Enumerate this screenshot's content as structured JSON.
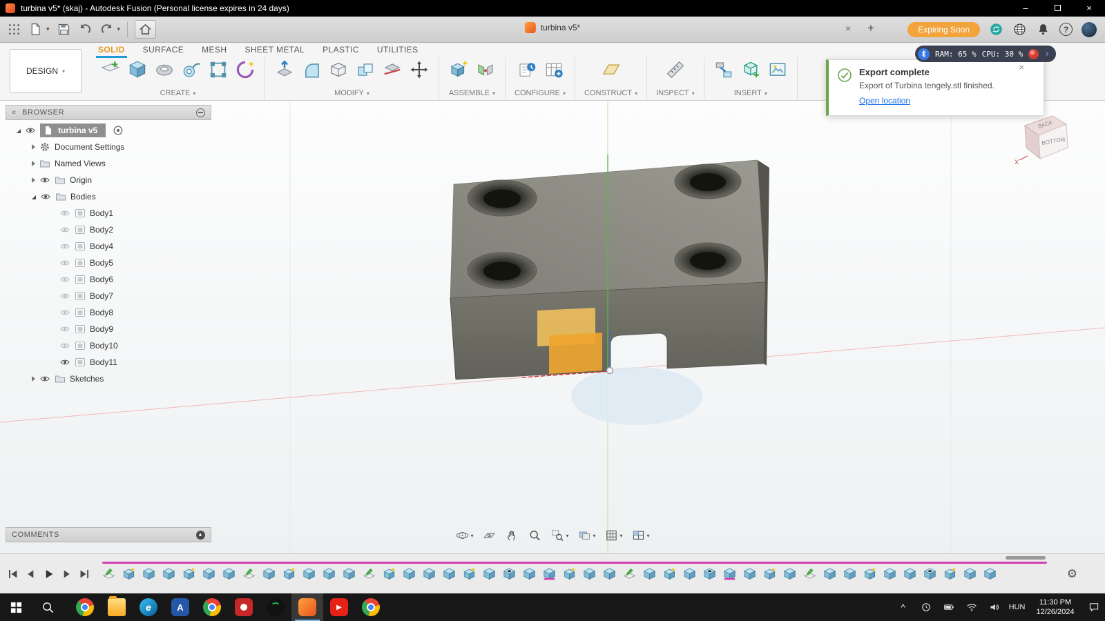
{
  "glyphs": {
    "close": "×",
    "minimize": "–",
    "caret_down": "▾",
    "plus": "+",
    "chevron": "›",
    "caret_up": "^",
    "gear": "⚙",
    "collapse_left": "«",
    "question": "?"
  },
  "titlebar": {
    "title": "turbina v5* (skaj) - Autodesk Fusion (Personal license expires in 24 days)"
  },
  "qat": {
    "doc_tab": "turbina v5*",
    "license_badge": "Expiring Soon"
  },
  "ribbon": {
    "design_menu": "DESIGN",
    "tabs": [
      {
        "label": "SOLID",
        "active": true
      },
      {
        "label": "SURFACE"
      },
      {
        "label": "MESH"
      },
      {
        "label": "SHEET METAL"
      },
      {
        "label": "PLASTIC"
      },
      {
        "label": "UTILITIES"
      }
    ],
    "groups": [
      {
        "label": "CREATE",
        "icons": [
          "create-sketch",
          "new-box",
          "revolve",
          "sweep",
          "pattern",
          "coil"
        ]
      },
      {
        "label": "MODIFY",
        "icons": [
          "press-pull",
          "fillet",
          "shell",
          "combine",
          "split",
          "move"
        ]
      },
      {
        "label": "ASSEMBLE",
        "icons": [
          "new-component",
          "joint"
        ]
      },
      {
        "label": "CONFIGURE",
        "icons": [
          "configuration",
          "config-table"
        ]
      },
      {
        "label": "CONSTRUCT",
        "icons": [
          "construction-plane"
        ]
      },
      {
        "label": "INSPECT",
        "icons": [
          "measure"
        ]
      },
      {
        "label": "INSERT",
        "icons": [
          "insert-derive",
          "insert-mesh",
          "canvas"
        ]
      }
    ]
  },
  "notification": {
    "title": "Export complete",
    "message": "Export of Turbina tengely.stl finished.",
    "link": "Open location"
  },
  "perf_overlay": {
    "ram": "RAM: 65 %",
    "cpu": "CPU: 30 %"
  },
  "browser": {
    "header": "BROWSER",
    "root": "turbina v5",
    "tree": [
      {
        "label": "Document Settings",
        "icon": "gear",
        "eye": false,
        "arrow": "collapsed"
      },
      {
        "label": "Named Views",
        "icon": "folder",
        "eye": false,
        "arrow": "collapsed"
      },
      {
        "label": "Origin",
        "icon": "folder",
        "eye": true,
        "arrow": "collapsed"
      },
      {
        "label": "Bodies",
        "icon": "folder",
        "eye": true,
        "arrow": "expanded",
        "children": [
          {
            "label": "Body1",
            "visible": false
          },
          {
            "label": "Body2",
            "visible": false
          },
          {
            "label": "Body4",
            "visible": false
          },
          {
            "label": "Body5",
            "visible": false
          },
          {
            "label": "Body6",
            "visible": false
          },
          {
            "label": "Body7",
            "visible": false
          },
          {
            "label": "Body8",
            "visible": false
          },
          {
            "label": "Body9",
            "visible": false
          },
          {
            "label": "Body10",
            "visible": false
          },
          {
            "label": "Body11",
            "visible": true
          }
        ]
      },
      {
        "label": "Sketches",
        "icon": "folder",
        "eye": true,
        "arrow": "collapsed"
      }
    ]
  },
  "viewcube": {
    "back": "BACK",
    "bottom": "BOTTOM",
    "axis_x": "X"
  },
  "comments": {
    "label": "COMMENTS"
  },
  "navbar": {
    "tools": [
      {
        "id": "orbit",
        "caret": true
      },
      {
        "id": "look-at"
      },
      {
        "id": "pan"
      },
      {
        "id": "zoom"
      },
      {
        "id": "zoom-window",
        "caret": true
      },
      {
        "id": "display-settings",
        "caret": true
      },
      {
        "id": "layout-grid",
        "caret": true
      },
      {
        "id": "viewports",
        "caret": true
      }
    ]
  },
  "timeline": {
    "features": [
      "sketch",
      "box-star",
      "box",
      "box",
      "box-star",
      "box",
      "box",
      "sketch",
      "box",
      "box-star",
      "box",
      "box",
      "box",
      "sketch",
      "box-star",
      "box",
      "box",
      "box",
      "box-star",
      "box",
      "hole",
      "box",
      "pink",
      "box-star",
      "box",
      "box",
      "sketch",
      "box",
      "box-star",
      "box",
      "hole",
      "pink",
      "box",
      "box-star",
      "box",
      "sketch",
      "box",
      "box",
      "box-star",
      "box",
      "box",
      "hole",
      "box-star",
      "box",
      "box"
    ]
  },
  "taskbar": {
    "language": "HUN",
    "time": "11:30 PM",
    "date": "12/26/2024",
    "apps": [
      {
        "id": "chrome"
      },
      {
        "id": "explorer"
      },
      {
        "id": "edge",
        "glyph": "e"
      },
      {
        "id": "app-a",
        "glyph": "A"
      },
      {
        "id": "chrome2"
      },
      {
        "id": "camera"
      },
      {
        "id": "spotify"
      },
      {
        "id": "fusion",
        "active": true
      },
      {
        "id": "youtube",
        "glyph": "▶"
      },
      {
        "id": "chrome3"
      }
    ]
  },
  "colors": {
    "accent_blue": "#1f9bd6",
    "active_tab_orange": "#e9971e",
    "badge_orange": "#f2a33c",
    "selection_orange": "#f0a830",
    "success_green": "#6aa84f",
    "timeline_magenta": "#cf3fae"
  }
}
